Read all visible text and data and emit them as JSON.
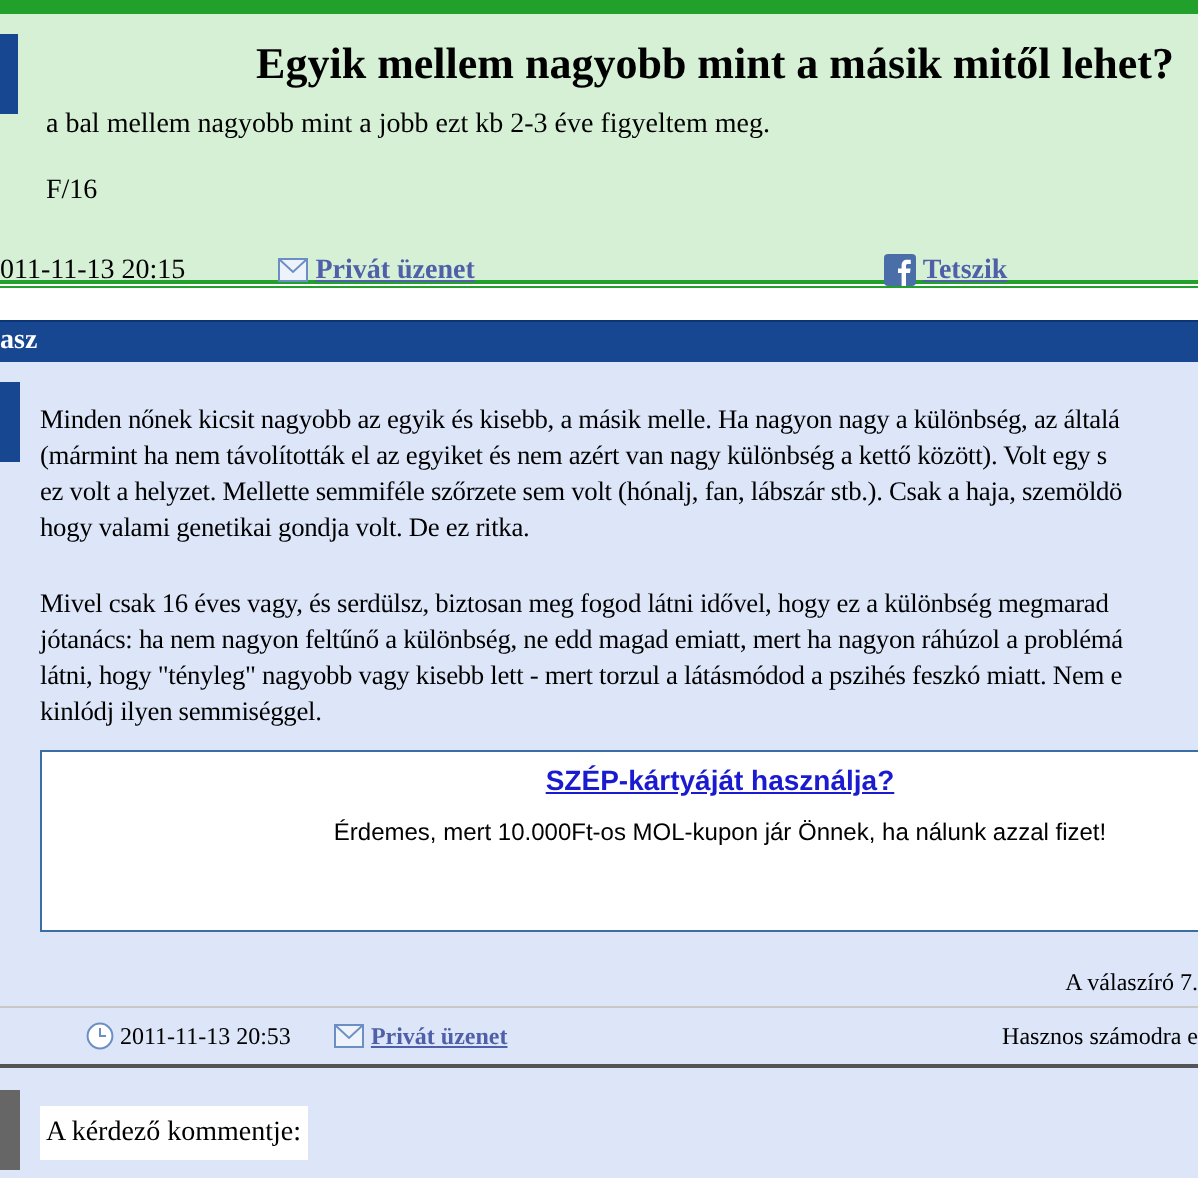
{
  "question": {
    "title": "Egyik mellem nagyobb mint a másik mitől lehet?",
    "paragraphs": [
      "a bal mellem nagyobb mint a jobb ezt kb 2-3 éve figyeltem meg.",
      "F/16"
    ],
    "date": "011-11-13 20:15",
    "message_link": "Privát üzenet",
    "like_link": "Tetszik"
  },
  "answer": {
    "header": "asz",
    "paragraphs": [
      [
        "Minden nőnek kicsit nagyobb az egyik és kisebb, a másik melle. Ha nagyon nagy a különbség, az általá",
        "(mármint ha nem távolították el az egyiket és nem azért van nagy különbség a kettő között). Volt egy s",
        "ez volt a helyzet. Mellette semmiféle szőrzete sem volt (hónalj, fan, lábszár stb.). Csak a haja, szemöldö",
        "hogy valami genetikai gondja volt. De ez ritka."
      ],
      [
        "Mivel csak 16 éves vagy, és serdülsz, biztosan meg fogod látni idővel, hogy ez a különbség megmarad",
        "jótanács: ha nem nagyon feltűnő a különbség, ne edd magad emiatt, mert ha nagyon ráhúzol a problémá",
        "látni, hogy \"tényleg\" nagyobb vagy kisebb lett - mert torzul a látásmódod a pszihés feszkó miatt. Nem e",
        "kinlódj ilyen semmiséggel."
      ]
    ],
    "ad": {
      "link": "SZÉP-kártyáját használja?",
      "text": "Érdemes, mert 10.000Ft-os MOL-kupon jár Önnek, ha nálunk azzal fizet!"
    },
    "author_note": "A válaszíró 7.",
    "date": "2011-11-13 20:53",
    "message_link": "Privát üzenet",
    "useful": "Hasznos számodra e"
  },
  "comment": {
    "label": "A kérdező kommentje:"
  }
}
